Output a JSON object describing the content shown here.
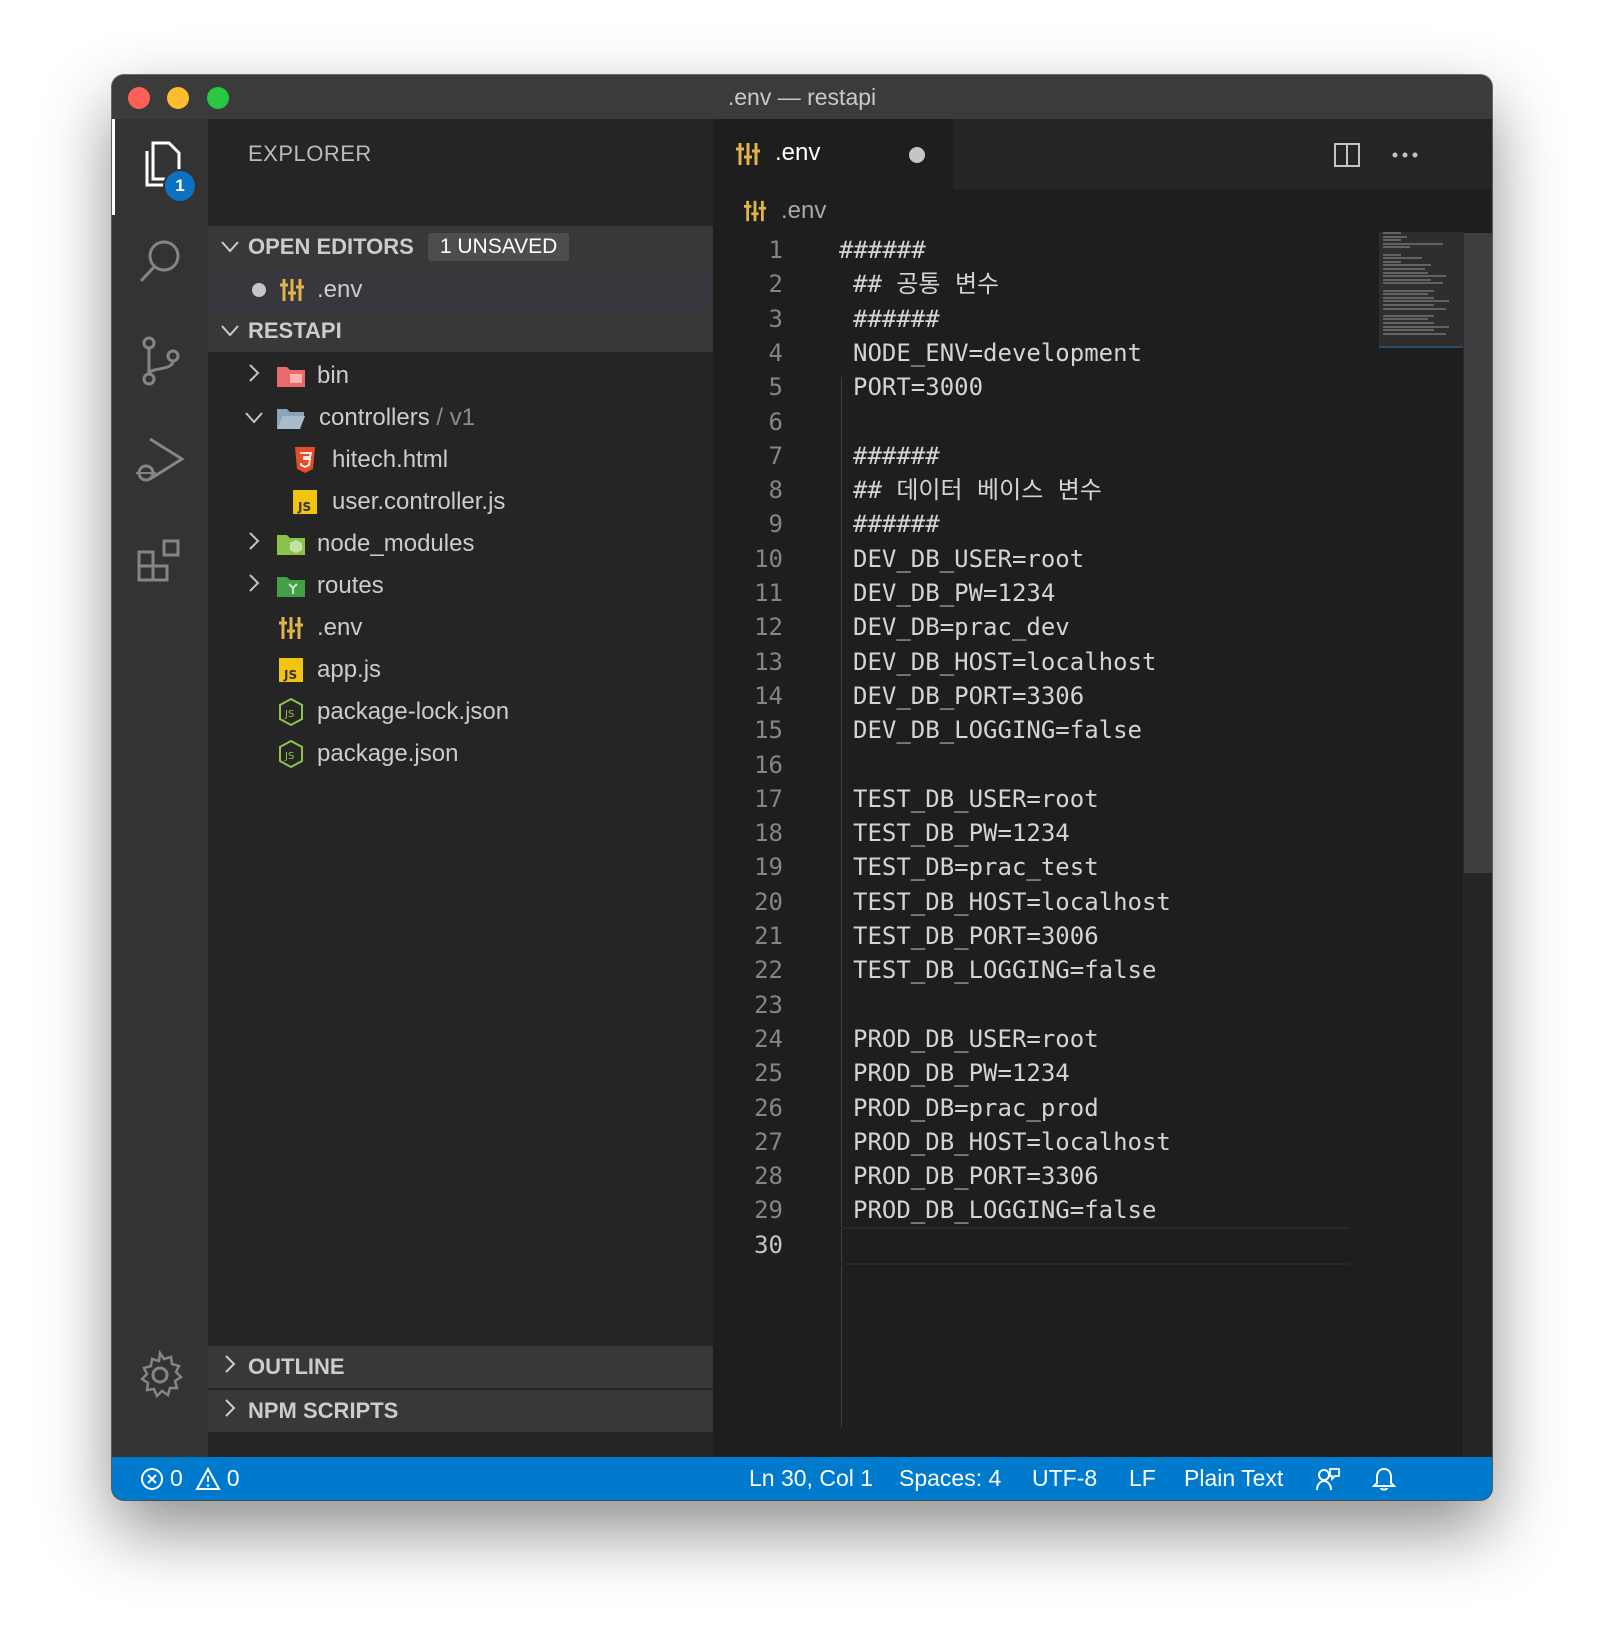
{
  "window": {
    "title": ".env — restapi"
  },
  "activity_bar": {
    "explorer_badge": "1",
    "items": [
      "explorer-icon",
      "search-icon",
      "source-control-icon",
      "run-debug-icon",
      "extensions-icon",
      "settings-gear-icon"
    ]
  },
  "sidebar": {
    "title": "EXPLORER",
    "open_editors": {
      "label": "OPEN EDITORS",
      "badge": "1 UNSAVED",
      "items": [
        {
          "name": ".env",
          "dirty": true,
          "icon": "env-settings-icon"
        }
      ]
    },
    "project": {
      "label": "RESTAPI",
      "tree": [
        {
          "label": "bin",
          "type": "folder",
          "expanded": false,
          "icon": "folder-bin-icon"
        },
        {
          "label": "controllers",
          "suffix": " / v1",
          "type": "folder",
          "expanded": true,
          "icon": "folder-open-icon"
        },
        {
          "label": "hitech.html",
          "type": "file",
          "icon": "html5-icon"
        },
        {
          "label": "user.controller.js",
          "type": "file",
          "icon": "javascript-icon"
        },
        {
          "label": "node_modules",
          "type": "folder",
          "expanded": false,
          "icon": "folder-node-icon"
        },
        {
          "label": "routes",
          "type": "folder",
          "expanded": false,
          "icon": "folder-routes-icon"
        },
        {
          "label": ".env",
          "type": "file",
          "icon": "env-settings-icon"
        },
        {
          "label": "app.js",
          "type": "file",
          "icon": "javascript-icon"
        },
        {
          "label": "package-lock.json",
          "type": "file",
          "icon": "nodejs-icon"
        },
        {
          "label": "package.json",
          "type": "file",
          "icon": "nodejs-icon"
        }
      ]
    },
    "outline_label": "OUTLINE",
    "npm_scripts_label": "NPM SCRIPTS"
  },
  "editor": {
    "tab_label": ".env",
    "breadcrumb": ".env",
    "active_line": 30,
    "lines": [
      "######",
      "## 공통 변수",
      "######",
      "NODE_ENV=development",
      "PORT=3000",
      "",
      "######",
      "## 데이터 베이스 변수",
      "######",
      "DEV_DB_USER=root",
      "DEV_DB_PW=1234",
      "DEV_DB=prac_dev",
      "DEV_DB_HOST=localhost",
      "DEV_DB_PORT=3306",
      "DEV_DB_LOGGING=false",
      "",
      "TEST_DB_USER=root",
      "TEST_DB_PW=1234",
      "TEST_DB=prac_test",
      "TEST_DB_HOST=localhost",
      "TEST_DB_PORT=3006",
      "TEST_DB_LOGGING=false",
      "",
      "PROD_DB_USER=root",
      "PROD_DB_PW=1234",
      "PROD_DB=prac_prod",
      "PROD_DB_HOST=localhost",
      "PROD_DB_PORT=3306",
      "PROD_DB_LOGGING=false",
      ""
    ]
  },
  "statusbar": {
    "errors": "0",
    "warnings": "0",
    "position": "Ln 30, Col 1",
    "spaces": "Spaces: 4",
    "encoding": "UTF-8",
    "eol": "LF",
    "language": "Plain Text"
  },
  "colors": {
    "accent": "#007acc",
    "editor_bg": "#1e1e1e",
    "sidebar_bg": "#252526",
    "activity_bg": "#333333"
  }
}
